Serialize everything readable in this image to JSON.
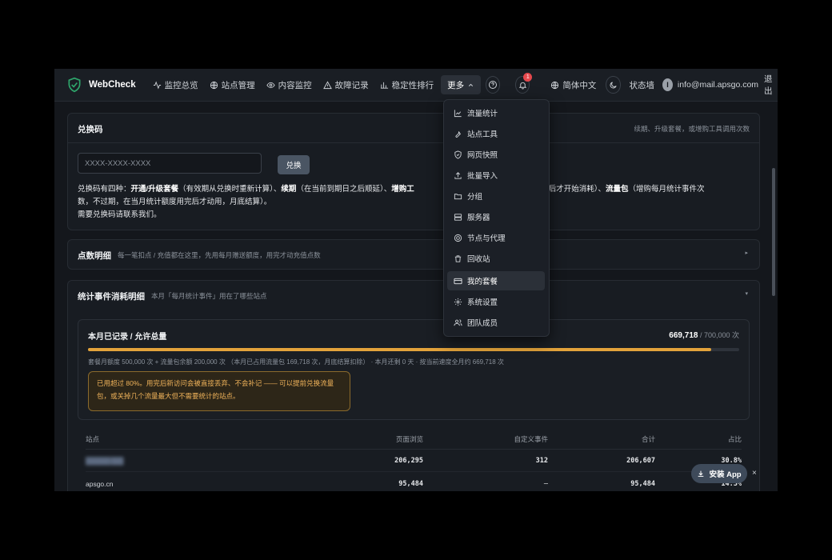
{
  "header": {
    "logo_text": "WebCheck",
    "nav": [
      {
        "label": "监控总览",
        "icon": "activity-icon"
      },
      {
        "label": "站点管理",
        "icon": "globe-icon"
      },
      {
        "label": "内容监控",
        "icon": "eye-icon"
      },
      {
        "label": "故障记录",
        "icon": "alert-triangle-icon"
      },
      {
        "label": "稳定性排行",
        "icon": "bar-chart-icon"
      }
    ],
    "more_label": "更多",
    "notification_count": "1",
    "language_label": "简体中文",
    "status_wall_label": "状态墙",
    "avatar_letter": "I",
    "user_email": "info@mail.apsgo.com",
    "logout_label": "退出"
  },
  "redeem": {
    "title": "兑换码",
    "hint": "续期、升级套餐，或增购工具调用次数",
    "input_placeholder": "XXXX-XXXX-XXXX",
    "button_label": "兑换",
    "desc_prefix": "兑换码有四种：",
    "desc_kw1": "开通/升级套餐",
    "desc_p1": "（有效期从兑换时重新计算）、",
    "desc_kw2": "续期",
    "desc_p2": "（在当前到期日之后顺延）、",
    "desc_kw3": "增购工",
    "desc_p3": "额度用完后才开始消耗）、",
    "desc_kw4": "流量包",
    "desc_p4": "（增购每月统计事件次",
    "desc_line2": "数，不过期，在当月统计额度用完后才动用，月底结算）。",
    "desc_line3": "需要兑换码请联系我们。"
  },
  "points": {
    "title": "点数明细",
    "subtitle": "每一笔扣点 / 充值都在这里，先用每月赠送额度，用完才动充值点数"
  },
  "stats": {
    "title": "统计事件消耗明细",
    "subtitle": "本月「每月统计事件」用在了哪些站点",
    "usage_label": "本月已记录 / 允许总量",
    "used": "669,718",
    "total": " / 700,000 次",
    "progress": 0.957,
    "detail": "套餐月额度 500,000 次 + 流量包余额 200,000 次 （本月已占用流量包 169,718 次，月底结算扣除） · 本月还剩 0 天 · 按当前速度全月约 669,718 次",
    "warning": "已用超过 80%。用完后新访问会被直接丢弃、不会补记 —— 可以提前兑换流量包，或关掉几个流量最大但不需要统计的站点。",
    "table": {
      "headers": [
        "站点",
        "页面浏览",
        "自定义事件",
        "合计",
        "占比"
      ],
      "rows": [
        [
          "██████ ███",
          "206,295",
          "312",
          "206,607",
          "30.8%"
        ],
        [
          "apsgo.cn",
          "95,484",
          "–",
          "95,484",
          "14.3%"
        ]
      ]
    }
  },
  "dropdown": {
    "items": [
      {
        "label": "流量统计",
        "icon": "line-chart-icon"
      },
      {
        "label": "站点工具",
        "icon": "wrench-icon"
      },
      {
        "label": "网页快照",
        "icon": "shield-icon"
      },
      {
        "label": "批量导入",
        "icon": "upload-icon"
      },
      {
        "label": "分组",
        "icon": "folder-icon"
      },
      {
        "label": "服务器",
        "icon": "server-icon"
      },
      {
        "label": "节点与代理",
        "icon": "proxy-icon"
      },
      {
        "label": "回收站",
        "icon": "trash-icon"
      },
      {
        "label": "我的套餐",
        "icon": "credit-card-icon"
      },
      {
        "label": "系统设置",
        "icon": "gear-icon"
      },
      {
        "label": "团队成员",
        "icon": "users-icon"
      }
    ]
  },
  "install_app_label": "安装 App",
  "close_glyph": "×"
}
